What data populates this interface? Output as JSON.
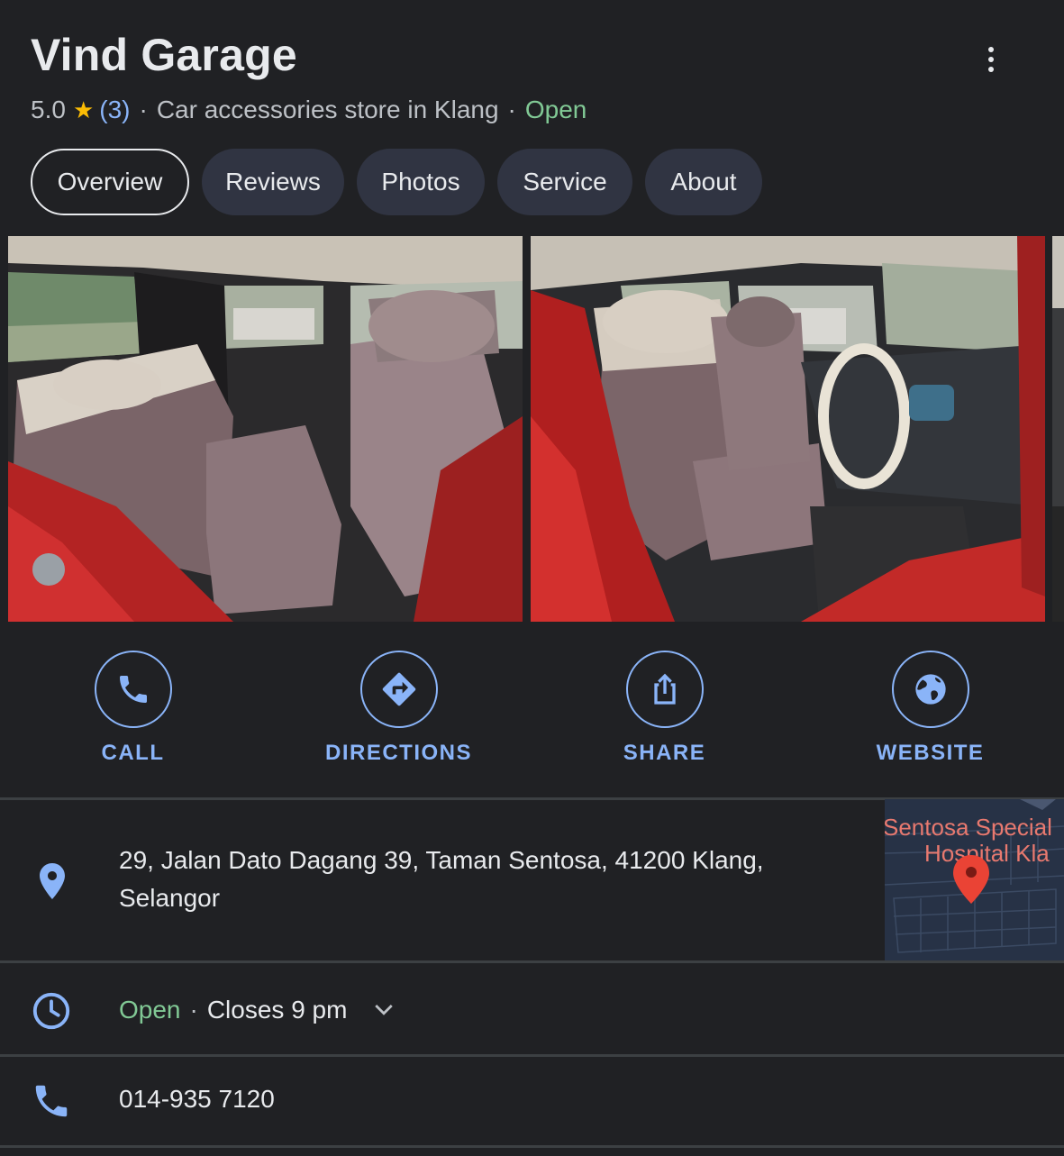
{
  "place": {
    "name": "Vind Garage",
    "rating": "5.0",
    "review_count": "(3)",
    "category": "Car accessories store in Klang",
    "separator": "·",
    "status": "Open"
  },
  "tabs": [
    {
      "label": "Overview",
      "active": true
    },
    {
      "label": "Reviews"
    },
    {
      "label": "Photos"
    },
    {
      "label": "Service"
    },
    {
      "label": "About"
    }
  ],
  "photos": [
    {
      "subject": "car-interior-rear-seats"
    },
    {
      "subject": "car-interior-front-seats"
    },
    {
      "subject": "car-interior-partial"
    }
  ],
  "actions": [
    {
      "label": "CALL",
      "icon": "phone-icon"
    },
    {
      "label": "DIRECTIONS",
      "icon": "directions-icon"
    },
    {
      "label": "SHARE",
      "icon": "share-icon"
    },
    {
      "label": "WEBSITE",
      "icon": "globe-icon"
    }
  ],
  "address": {
    "line1": "29, Jalan Dato Dagang 39, Taman Sentosa, 41200 Klang,",
    "line2": "Selangor",
    "icon": "location-pin-icon"
  },
  "map": {
    "label_line1": "Sentosa Special",
    "label_line2": "Hospital Kla"
  },
  "hours": {
    "status": "Open",
    "separator": "·",
    "closes": "Closes 9 pm",
    "icon": "clock-icon"
  },
  "phone": {
    "number": "014-935 7120",
    "icon": "phone-icon"
  },
  "colors": {
    "background": "#202124",
    "accent": "#8ab4f8",
    "open_green": "#81c995",
    "star": "#fbbc04",
    "chip": "#303442"
  }
}
